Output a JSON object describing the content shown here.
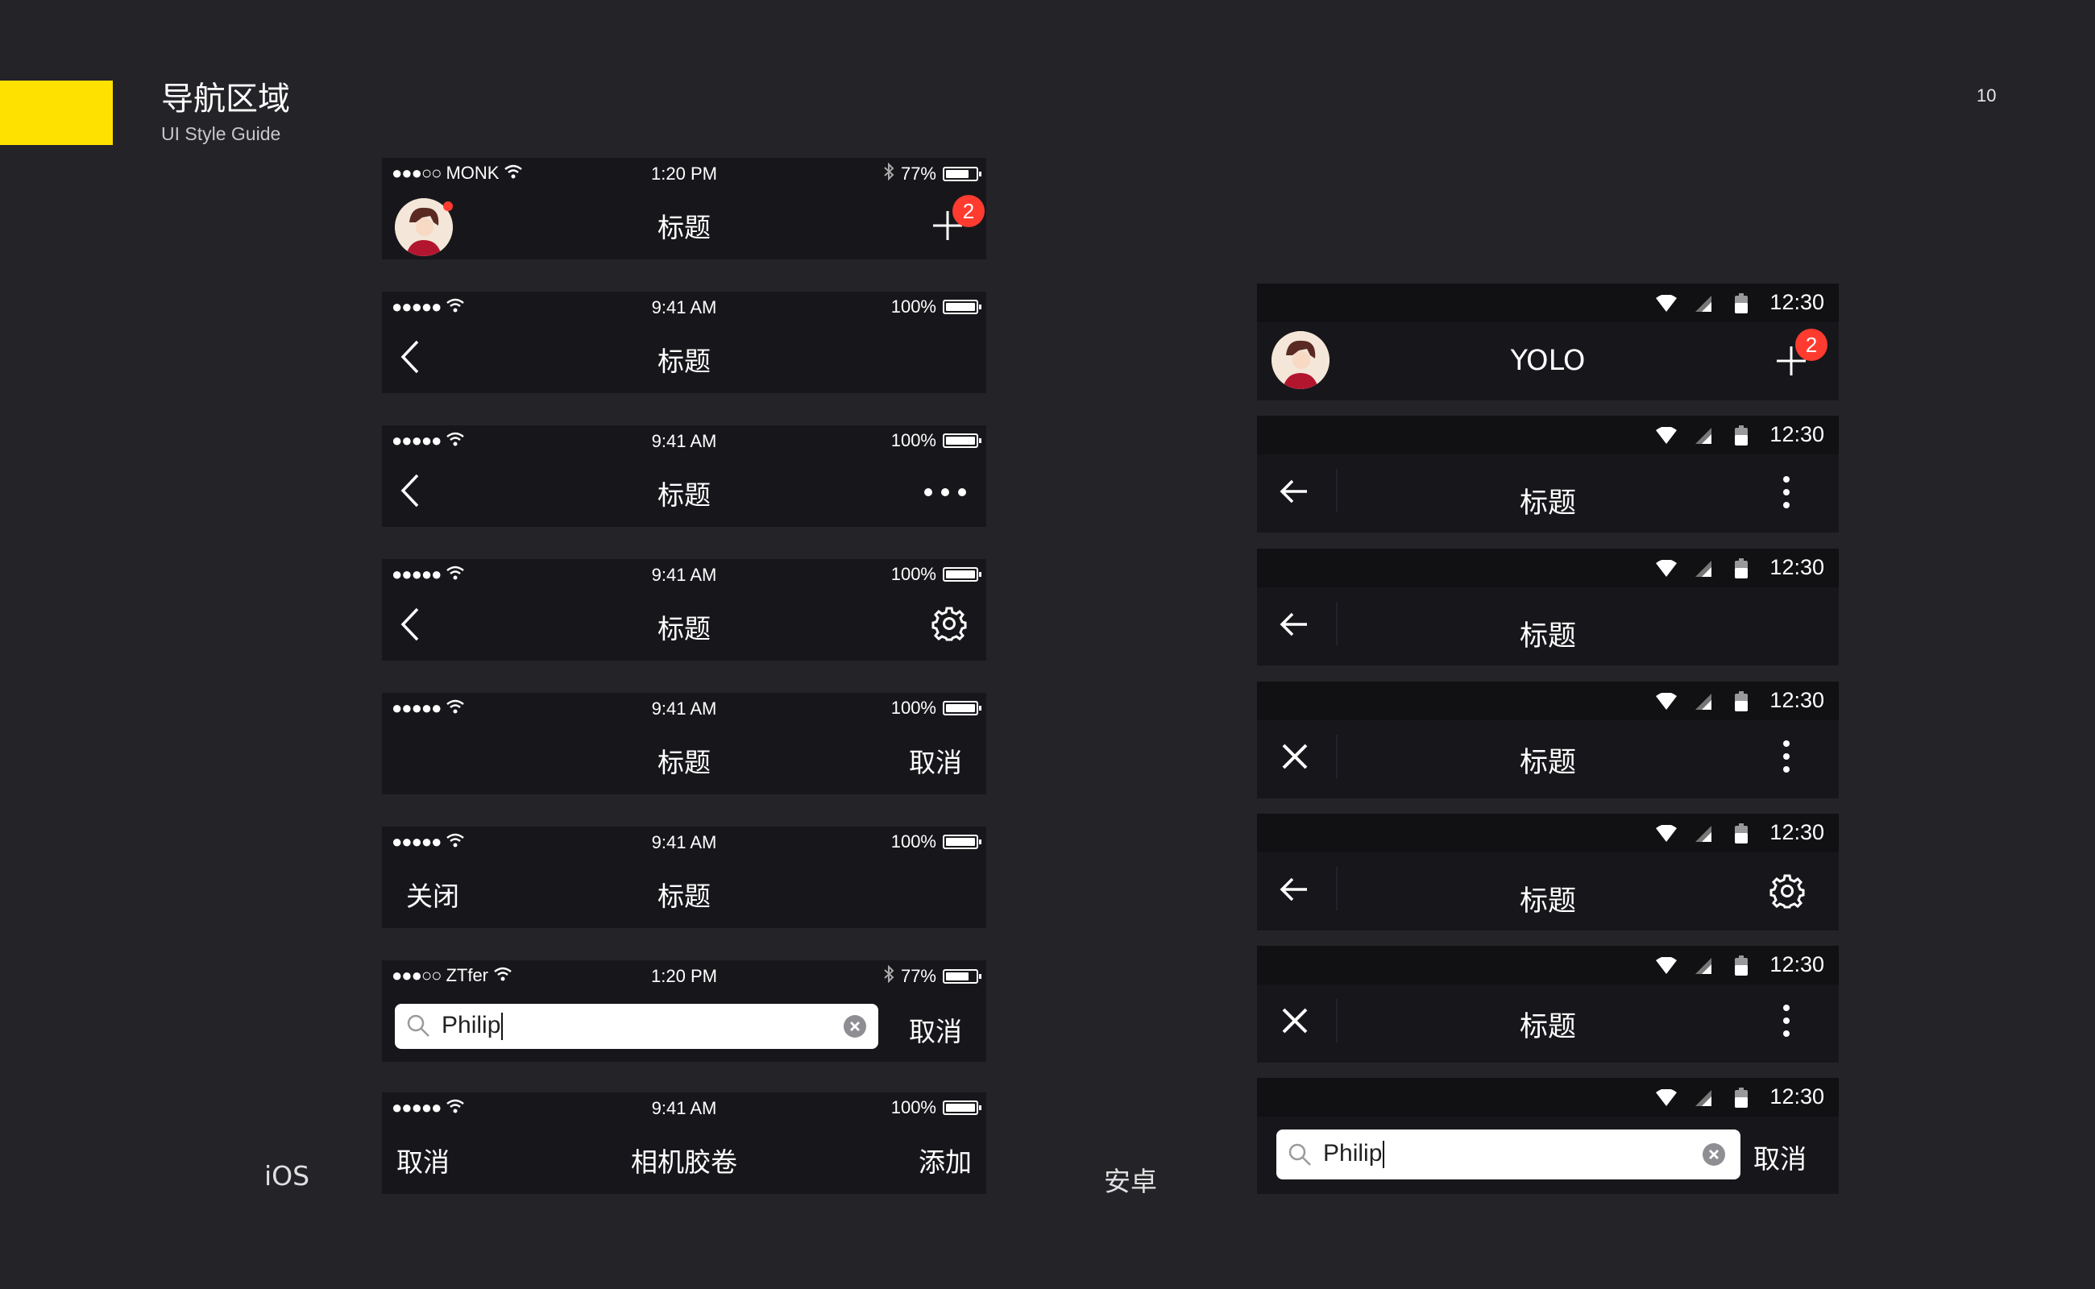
{
  "header": {
    "title": "导航区域",
    "subtitle": "UI Style Guide",
    "page_number": "10"
  },
  "labels": {
    "ios": "iOS",
    "android": "安卓"
  },
  "colors": {
    "background": "#232328",
    "bar": "#17171b",
    "accent": "#ffe100",
    "badge": "#ff3b30"
  },
  "ios_bars": [
    {
      "carrier": "MONK",
      "signal": "●●●○○",
      "time": "1:20 PM",
      "battery": "77%",
      "battery_level": 0.77,
      "title": "标题",
      "badge": "2"
    },
    {
      "signal": "●●●●●",
      "time": "9:41 AM",
      "battery": "100%",
      "battery_level": 1.0,
      "title": "标题"
    },
    {
      "signal": "●●●●●",
      "time": "9:41 AM",
      "battery": "100%",
      "battery_level": 1.0,
      "title": "标题"
    },
    {
      "signal": "●●●●●",
      "time": "9:41 AM",
      "battery": "100%",
      "battery_level": 1.0,
      "title": "标题"
    },
    {
      "signal": "●●●●●",
      "time": "9:41 AM",
      "battery": "100%",
      "battery_level": 1.0,
      "title": "标题",
      "right": "取消"
    },
    {
      "signal": "●●●●●",
      "time": "9:41 AM",
      "battery": "100%",
      "battery_level": 1.0,
      "title": "标题",
      "left": "关闭"
    },
    {
      "carrier": "ZTfer",
      "signal": "●●●○○",
      "time": "1:20 PM",
      "battery": "77%",
      "battery_level": 0.77,
      "search_value": "Philip",
      "right": "取消"
    },
    {
      "signal": "●●●●●",
      "time": "9:41 AM",
      "battery": "100%",
      "battery_level": 1.0,
      "title": "相机胶卷",
      "left": "取消",
      "right": "添加"
    }
  ],
  "android_bars": [
    {
      "time": "12:30",
      "title": "YOLO",
      "badge": "2"
    },
    {
      "time": "12:30",
      "title": "标题"
    },
    {
      "time": "12:30",
      "title": "标题"
    },
    {
      "time": "12:30",
      "title": "标题"
    },
    {
      "time": "12:30",
      "title": "标题"
    },
    {
      "time": "12:30",
      "title": "标题"
    },
    {
      "time": "12:30",
      "search_value": "Philip",
      "right": "取消"
    }
  ]
}
